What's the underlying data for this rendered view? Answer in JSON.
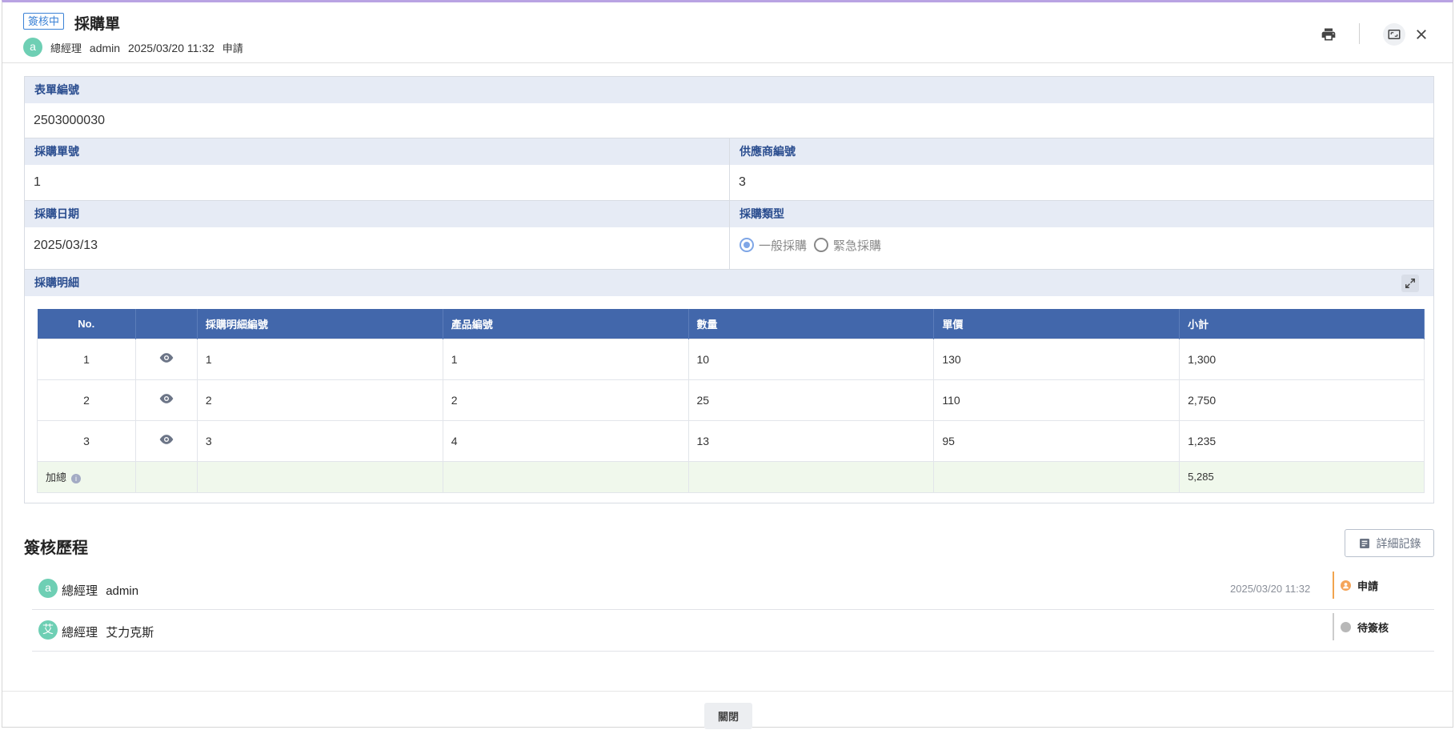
{
  "header": {
    "status_tag": "簽核中",
    "title": "採購單",
    "applicant_avatar": "a",
    "applicant_role": "總經理",
    "applicant_name": "admin",
    "applied_at": "2025/03/20 11:32",
    "action": "申請",
    "icons": [
      "print-icon",
      "maximize-icon",
      "close-icon"
    ]
  },
  "form": {
    "form_no_label": "表單編號",
    "form_no_value": "2503000030",
    "po_no_label": "採購單號",
    "po_no_value": "1",
    "supplier_no_label": "供應商編號",
    "supplier_no_value": "3",
    "po_date_label": "採購日期",
    "po_date_value": "2025/03/13",
    "po_type_label": "採購類型",
    "po_type_options": [
      "一般採購",
      "緊急採購"
    ],
    "po_type_selected": "一般採購",
    "detail_label": "採購明細"
  },
  "table": {
    "columns": [
      "No.",
      "",
      "採購明細編號",
      "產品編號",
      "數量",
      "單價",
      "小計"
    ],
    "rows": [
      {
        "no": "1",
        "detail_no": "1",
        "product_no": "1",
        "qty": "10",
        "price": "130",
        "subtotal": "1,300"
      },
      {
        "no": "2",
        "detail_no": "2",
        "product_no": "2",
        "qty": "25",
        "price": "110",
        "subtotal": "2,750"
      },
      {
        "no": "3",
        "detail_no": "3",
        "product_no": "4",
        "qty": "13",
        "price": "95",
        "subtotal": "1,235"
      }
    ],
    "sum_label": "加總",
    "sum_value": "5,285"
  },
  "history": {
    "title": "簽核歷程",
    "detail_button": "詳細記錄",
    "entries": [
      {
        "avatar": "a",
        "role": "總經理",
        "name": "admin",
        "time": "2025/03/20 11:32",
        "status": "申請",
        "status_color": "#f5a55a"
      },
      {
        "avatar": "艾",
        "role": "總經理",
        "name": "艾力克斯",
        "time": "",
        "status": "待簽核",
        "status_color": "#b8b8b8"
      }
    ]
  },
  "footer": {
    "close_button": "關閉"
  }
}
